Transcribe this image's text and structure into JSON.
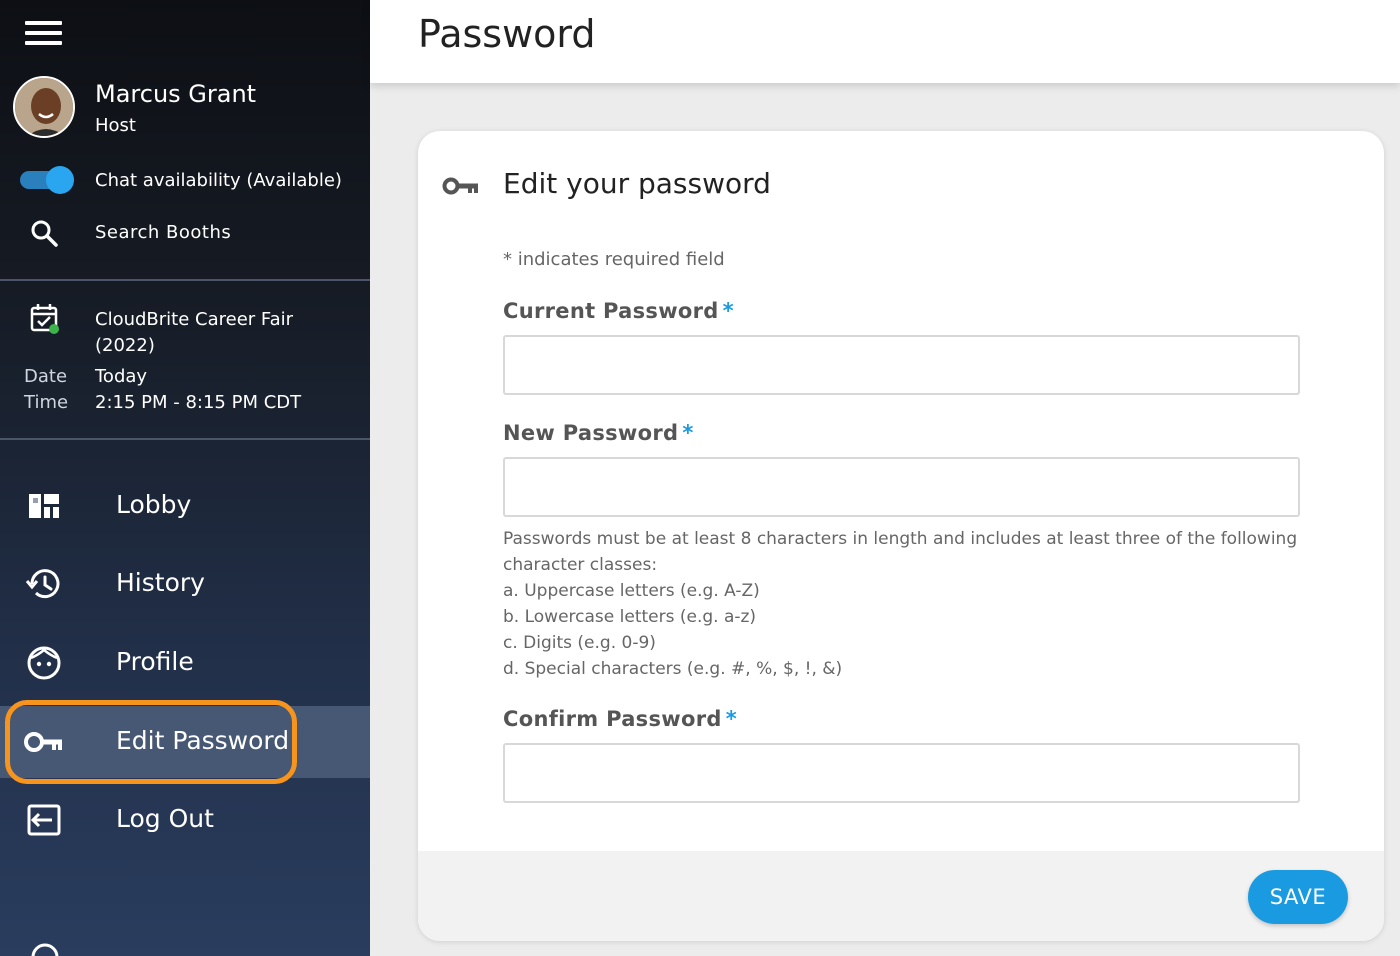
{
  "sidebar": {
    "user": {
      "name": "Marcus Grant",
      "role": "Host"
    },
    "chat_availability": "Chat availability (Available)",
    "search_label": "Search Booths",
    "event": {
      "name": "CloudBrite Career Fair (2022)",
      "date_label": "Date",
      "time_label": "Time",
      "date_value": "Today",
      "time_value": "2:15 PM - 8:15 PM CDT"
    },
    "nav": [
      {
        "label": "Lobby",
        "icon": "dashboard-icon"
      },
      {
        "label": "History",
        "icon": "history-icon"
      },
      {
        "label": "Profile",
        "icon": "face-icon"
      },
      {
        "label": "Edit Password",
        "icon": "key-icon",
        "active": true
      },
      {
        "label": "Log Out",
        "icon": "logout-icon"
      }
    ]
  },
  "header": {
    "title": "Password"
  },
  "form": {
    "title": "Edit your password",
    "required_note": "* indicates required field",
    "current_password_label": "Current Password",
    "new_password_label": "New Password",
    "confirm_password_label": "Confirm Password",
    "required_marker": "*",
    "hint_lines": [
      "Passwords must be at least 8 characters in length and includes at least three of the following character classes:",
      "a. Uppercase letters (e.g. A-Z)",
      "b. Lowercase letters (e.g. a-z)",
      "c. Digits (e.g. 0-9)",
      "d. Special characters (e.g. #, %, $, !, &)"
    ],
    "save_label": "SAVE"
  },
  "colors": {
    "accent": "#1a9ae0",
    "highlight": "#f7941d",
    "active_nav": "#465874"
  }
}
